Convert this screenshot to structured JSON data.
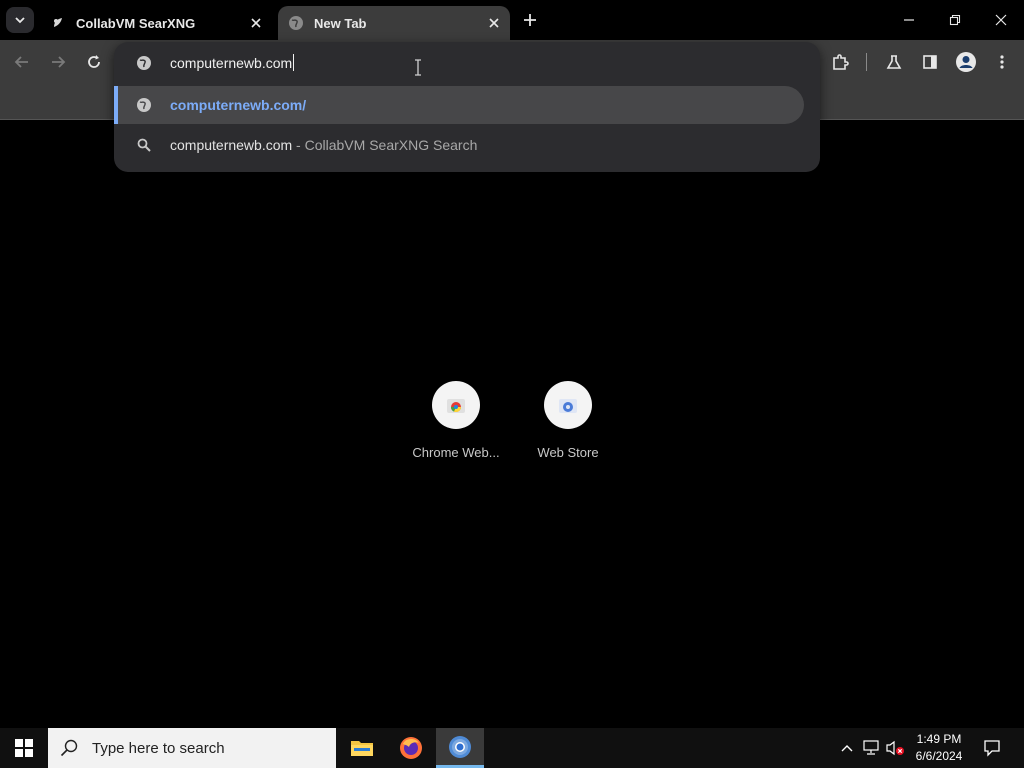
{
  "browser": {
    "tabs": [
      {
        "title": "CollabVM SearXNG",
        "active": false
      },
      {
        "title": "New Tab",
        "active": true
      }
    ]
  },
  "omnibox": {
    "input_value": "computernewb.com",
    "suggestions": [
      {
        "text": "computernewb.com/",
        "description": "",
        "icon": "globe-icon",
        "selected": true
      },
      {
        "text": "computernewb.com",
        "description": " - CollabVM SearXNG Search",
        "icon": "search-icon",
        "selected": false
      }
    ]
  },
  "shortcuts": [
    {
      "label": "Chrome Web..."
    },
    {
      "label": "Web Store"
    }
  ],
  "taskbar": {
    "search_placeholder": "Type here to search",
    "time": "1:49 PM",
    "date": "6/6/2024"
  },
  "colors": {
    "accent": "#7cacf8",
    "toolbar": "#3c3c3c",
    "omnibox": "#2c2c2f"
  }
}
